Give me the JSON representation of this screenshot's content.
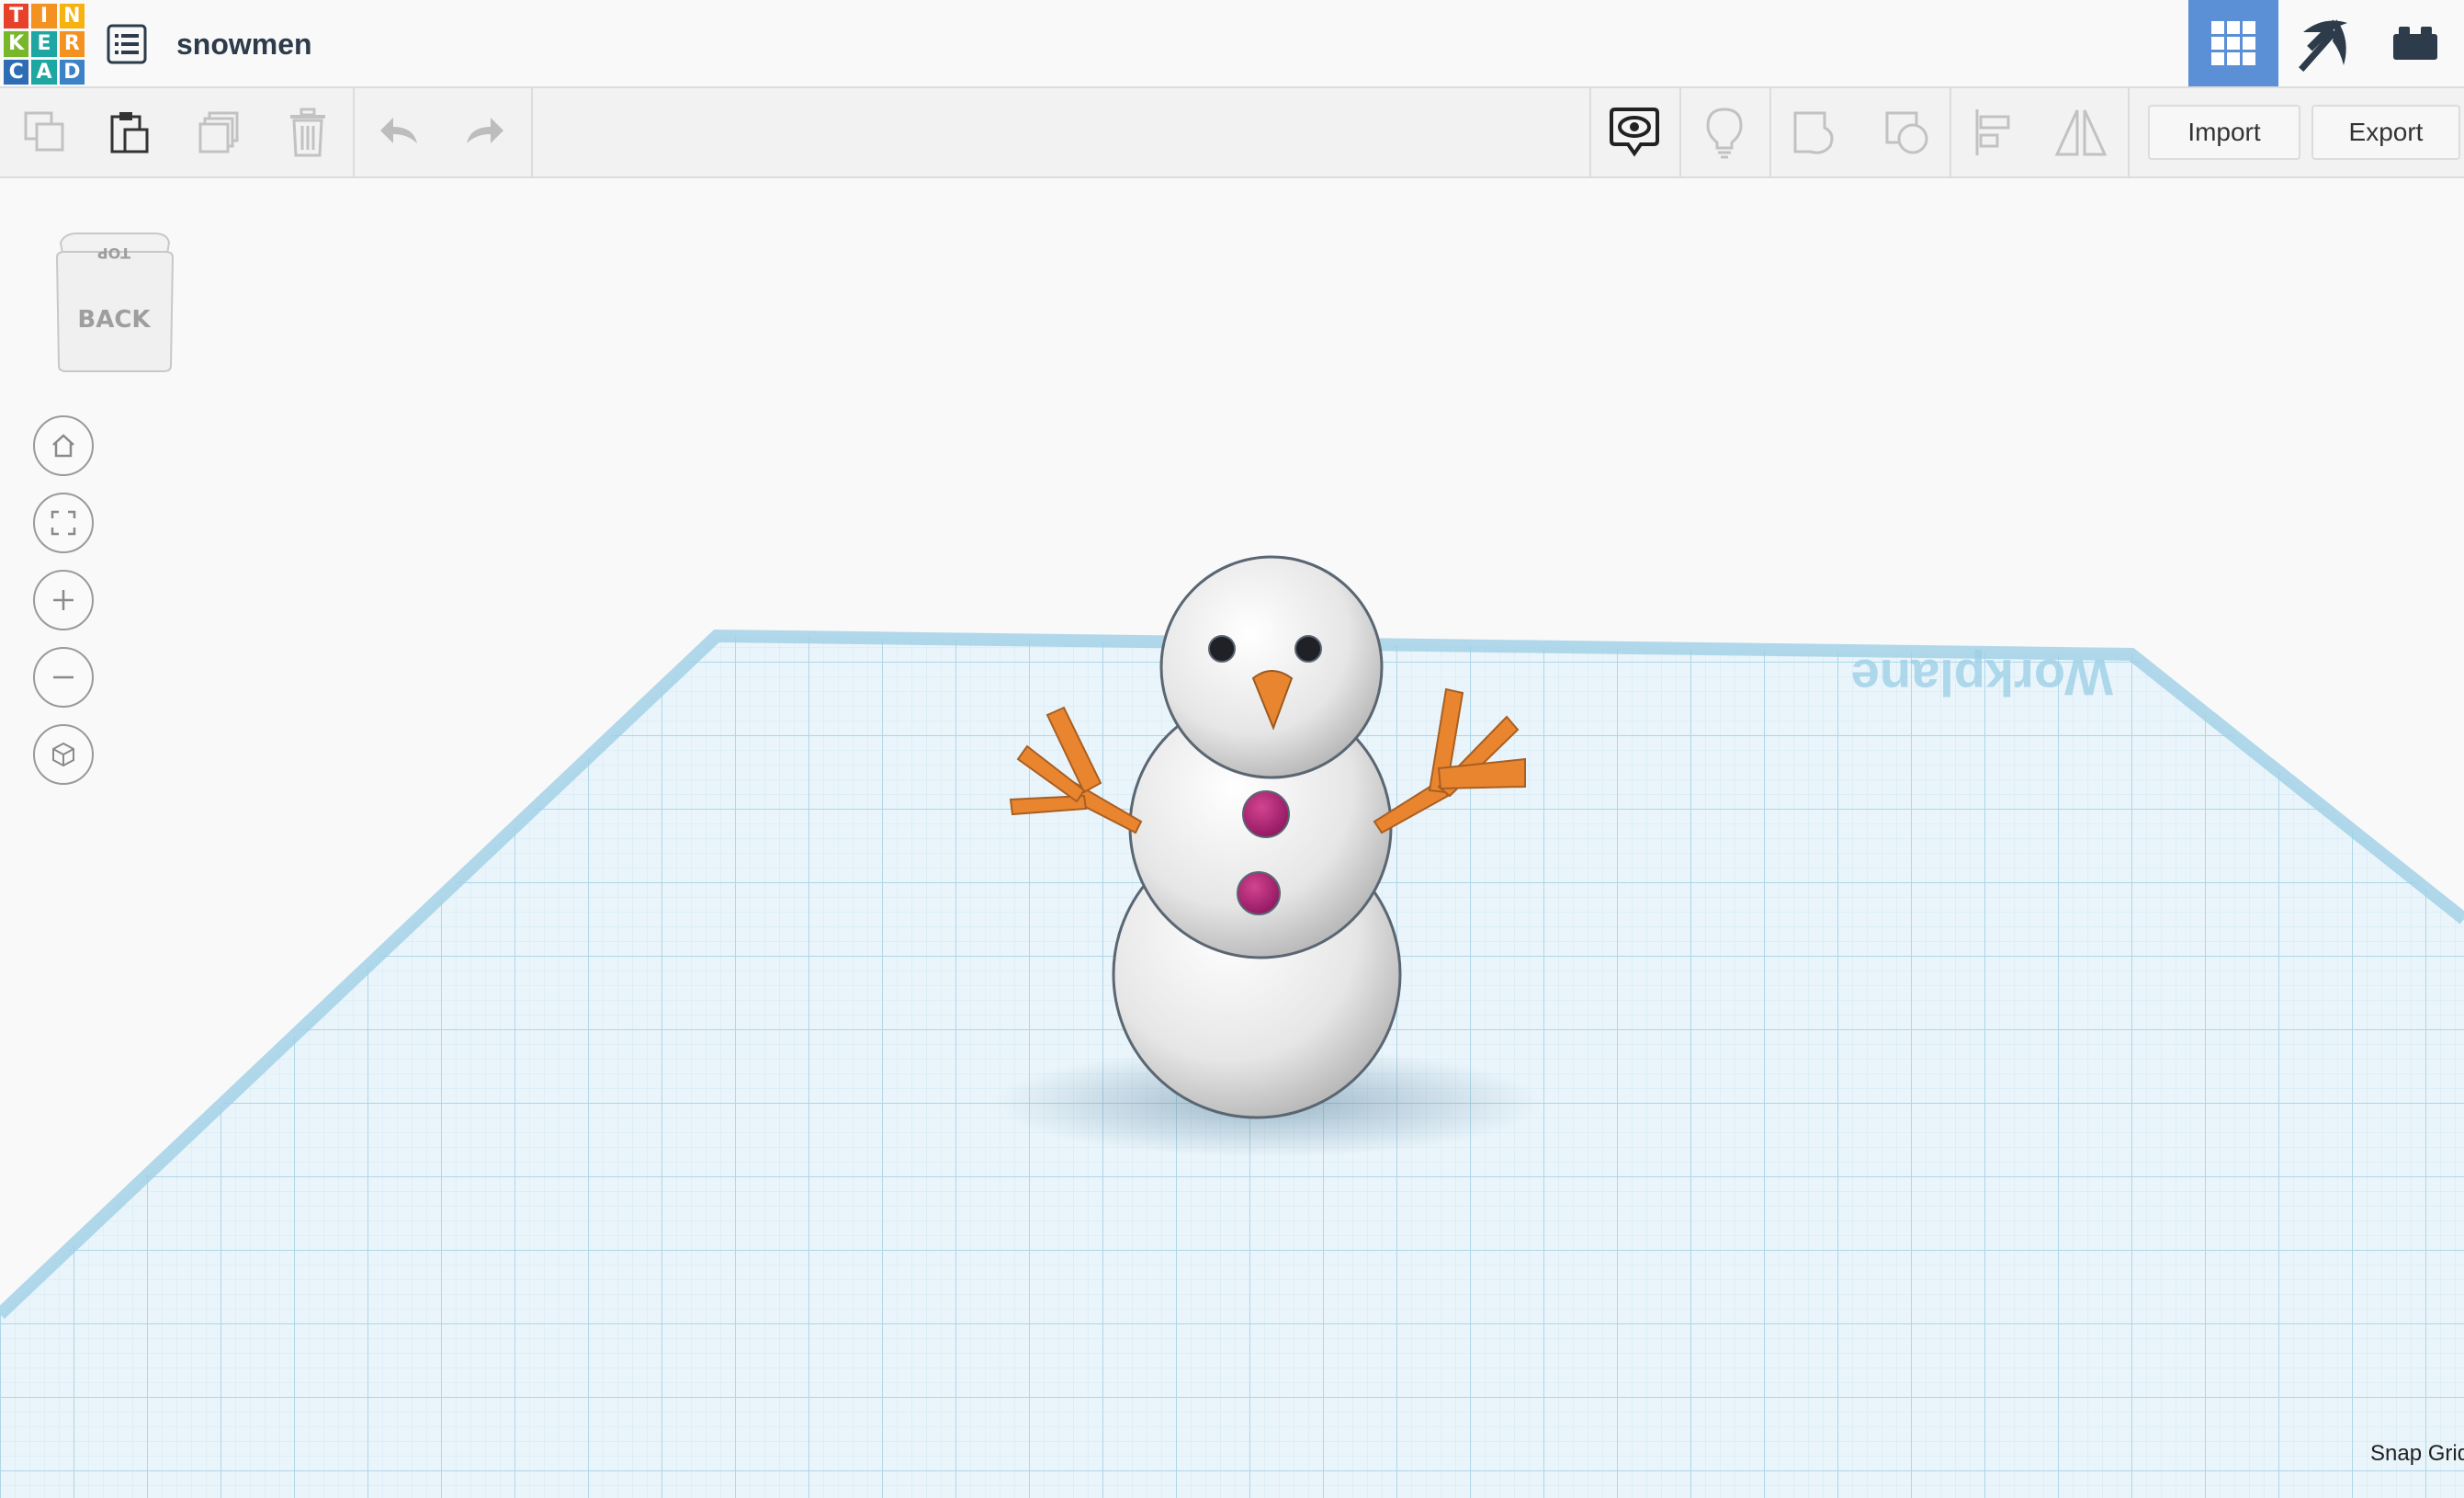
{
  "logo": {
    "letters": [
      "T",
      "I",
      "N",
      "K",
      "E",
      "R",
      "C",
      "A",
      "D"
    ],
    "colors": [
      "#e8412a",
      "#f39220",
      "#f6b20f",
      "#78b62a",
      "#1ea6a2",
      "#f39220",
      "#2e6db4",
      "#1ea6a2",
      "#3c82c6"
    ]
  },
  "header": {
    "title": "snowmen",
    "active_view": "3d-design"
  },
  "toolbar": {
    "import_label": "Import",
    "export_label": "Export"
  },
  "view_cube": {
    "front_label": "BACK",
    "top_label": "TOP"
  },
  "workplane": {
    "label": "Workplane"
  },
  "footer": {
    "snap_grid_label": "Snap Grid"
  },
  "colors": {
    "accent": "#5b8fd6",
    "grid": "#c9e6f3",
    "orange": "#e9852f",
    "button": "#b11e74"
  }
}
